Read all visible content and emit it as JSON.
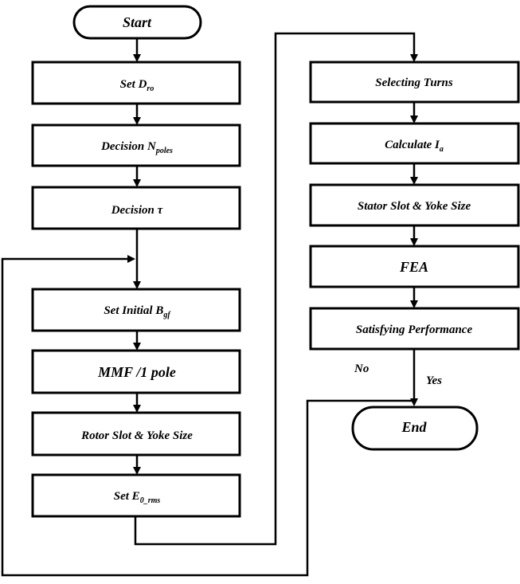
{
  "nodes": {
    "start": "Start",
    "set_dro": {
      "main": "Set D",
      "sub": "ro"
    },
    "decision_npoles": {
      "main": "Decision N",
      "sub": "poles"
    },
    "decision_tau": "Decision  τ",
    "set_bgf": {
      "main": "Set Initial B",
      "sub": "gf"
    },
    "mmf": "MMF /1 pole",
    "rotor": "Rotor Slot & Yoke Size",
    "set_e0": {
      "main": "Set  E",
      "sub": "0_rms"
    },
    "turns": "Selecting Turns",
    "calc_ia": {
      "main": "Calculate I",
      "sub": "a"
    },
    "stator": "Stator Slot & Yoke Size",
    "fea": "FEA",
    "satisfying": "Satisfying Performance",
    "end": "End"
  },
  "edges": {
    "no": "No",
    "yes": "Yes"
  }
}
